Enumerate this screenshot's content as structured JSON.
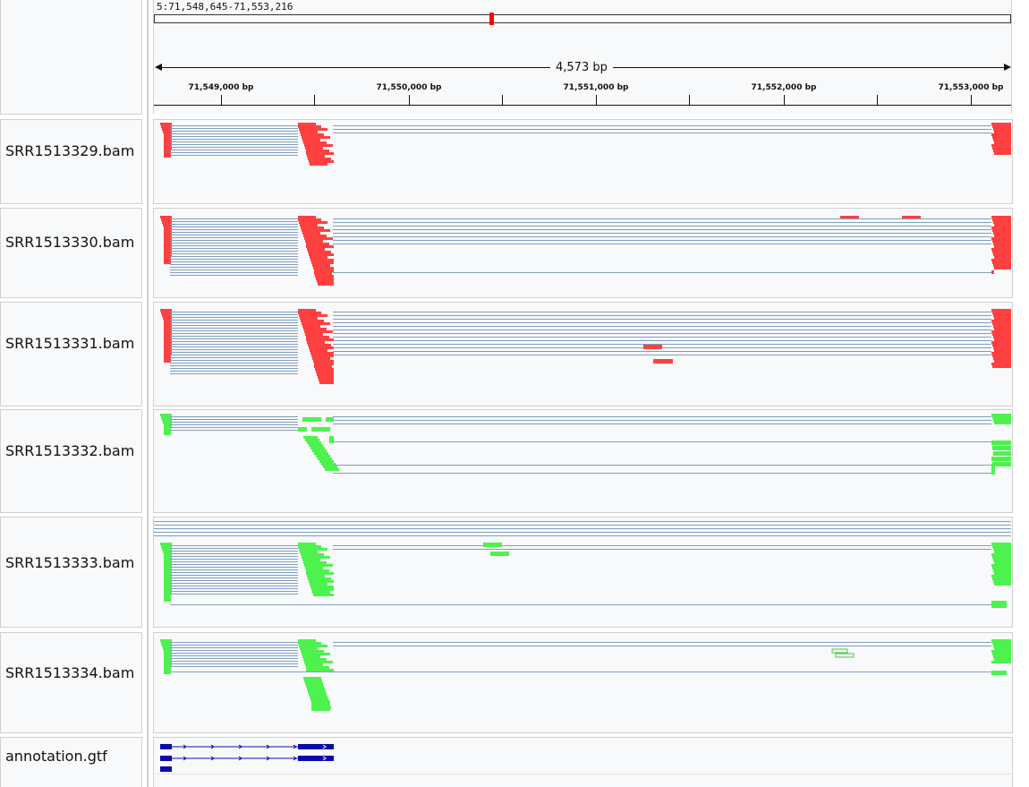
{
  "header": {
    "locus": "5:71,548,645-71,553,216",
    "span": "4,573 bp",
    "ticks": [
      "71,549,000 bp",
      "71,550,000 bp",
      "71,551,000 bp",
      "71,552,000 bp",
      "71,553,000 bp"
    ]
  },
  "tracks": [
    {
      "name": "SRR1513329.bam",
      "color": "#ff4040"
    },
    {
      "name": "SRR1513330.bam",
      "color": "#ff4040"
    },
    {
      "name": "SRR1513331.bam",
      "color": "#ff4040"
    },
    {
      "name": "SRR1513332.bam",
      "color": "#4ef24e"
    },
    {
      "name": "SRR1513333.bam",
      "color": "#4ef24e"
    },
    {
      "name": "SRR1513334.bam",
      "color": "#4ef24e"
    }
  ],
  "annotation": {
    "name": "annotation.gtf",
    "color": "#0a0aa8"
  },
  "colors": {
    "junction_line": "#7f9fbf",
    "panel_bg": "#f8f9fa"
  }
}
